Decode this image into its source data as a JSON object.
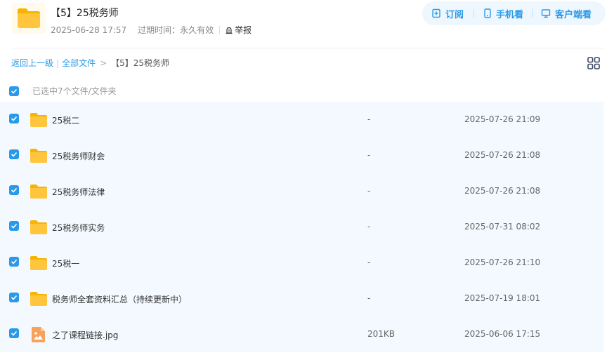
{
  "share": {
    "title": "【5】25税务师",
    "date": "2025-06-28 17:57",
    "expire_label": "过期时间：永久有效",
    "report_label": "举报"
  },
  "actions": {
    "subscribe": "订阅",
    "mobile": "手机看",
    "client": "客户端看"
  },
  "breadcrumb": {
    "back": "返回上一级",
    "all": "全部文件",
    "arrow": ">",
    "current": "【5】25税务师"
  },
  "selection": {
    "text": "已选中7个文件/文件夹"
  },
  "files": [
    {
      "name": "25税二",
      "size": "-",
      "date": "2025-07-26 21:09",
      "type": "folder",
      "icon": "folder-icon"
    },
    {
      "name": "25税务师财会",
      "size": "-",
      "date": "2025-07-26 21:08",
      "type": "folder",
      "icon": "folder-icon"
    },
    {
      "name": "25税务师法律",
      "size": "-",
      "date": "2025-07-26 21:08",
      "type": "folder",
      "icon": "folder-icon"
    },
    {
      "name": "25税务师实务",
      "size": "-",
      "date": "2025-07-31 08:02",
      "type": "folder",
      "icon": "folder-icon"
    },
    {
      "name": "25税一",
      "size": "-",
      "date": "2025-07-26 21:10",
      "type": "folder",
      "icon": "folder-icon"
    },
    {
      "name": "税务师全套资料汇总（持续更新中）",
      "size": "-",
      "date": "2025-07-19 18:01",
      "type": "folder",
      "icon": "folder-icon"
    },
    {
      "name": "之了课程链接.jpg",
      "size": "201KB",
      "date": "2025-06-06 17:15",
      "type": "image",
      "icon": "image-file-icon"
    }
  ],
  "colors": {
    "accent": "#2a9ae8",
    "row_bg": "#f3f9fe",
    "folder": "#ffc53d",
    "image_file": "#f7a15a"
  }
}
